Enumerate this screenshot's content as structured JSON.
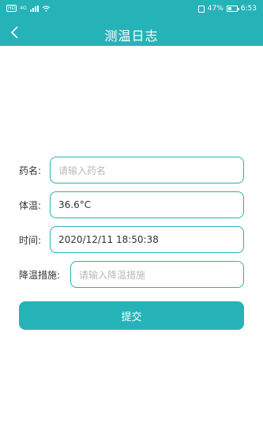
{
  "status_bar": {
    "left_badge": "HD",
    "network": "4G",
    "battery_text": "47%",
    "battery_level": 0.47,
    "time": "6:53"
  },
  "header": {
    "title": "测温日志",
    "back_icon": "chevron-left-icon"
  },
  "form": {
    "medicine": {
      "label": "药名:",
      "value": "",
      "placeholder": "请输入药名"
    },
    "temperature": {
      "label": "体温:",
      "value": "36.6°C",
      "placeholder": ""
    },
    "time": {
      "label": "时间:",
      "value": "2020/12/11 18:50:38",
      "placeholder": ""
    },
    "cooling": {
      "label": "降温措施:",
      "value": "",
      "placeholder": "请输入降温措施"
    }
  },
  "submit_label": "提交",
  "colors": {
    "accent": "#26b3b8",
    "background": "#ffffff"
  }
}
